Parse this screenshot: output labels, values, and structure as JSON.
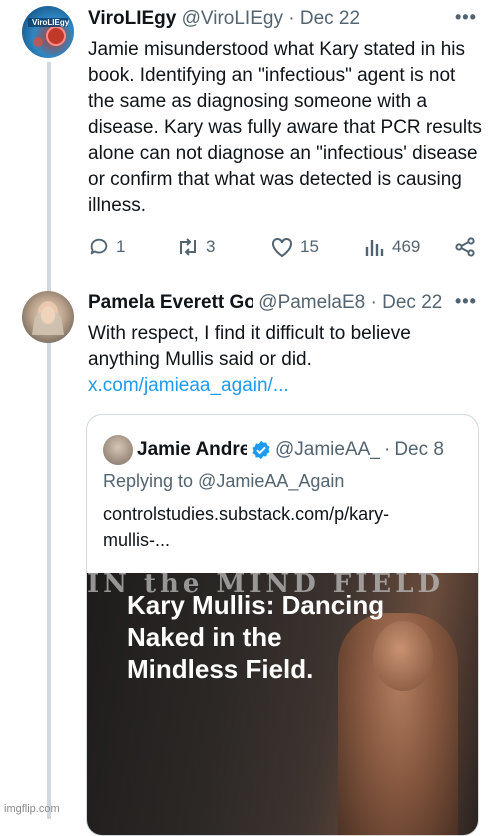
{
  "tweet1": {
    "avatar_text": "ViroLIEgy",
    "name": "ViroLIEgy",
    "handle": "@ViroLIEgy",
    "sep": "·",
    "date": "Dec 22",
    "text": "Jamie misunderstood what Kary stated in his book. Identifying an \"infectious\" agent is not the same as diagnosing someone with a disease. Kary was fully aware that PCR results alone can not diagnose an \"infectious' disease or confirm that what was detected is causing illness.",
    "actions": {
      "replies": "1",
      "reposts": "3",
      "likes": "15",
      "views": "469"
    }
  },
  "tweet2": {
    "name": "Pamela Everett Go",
    "handle": "@PamelaE8",
    "sep": "·",
    "date": "Dec 22",
    "text": "With respect, I find it difficult to believe anything Mullis said or did.",
    "link": "x.com/jamieaa_again/..."
  },
  "quote": {
    "name": "Jamie Andre",
    "handle": "@JamieAA_A",
    "sep": "·",
    "date": "Dec 8",
    "replying": "Replying to @JamieAA_Again",
    "url": "controlstudies.substack.com/p/kary-mullis-...",
    "media_top_text": "IN the MIND FIELD",
    "media_title": "Kary Mullis: Dancing Naked in the Mindless Field."
  },
  "more_icon": "•••",
  "watermark": "imgflip.com",
  "colors": {
    "link": "#1d9bf0",
    "muted": "#536471",
    "verified": "#1d9bf0",
    "thread": "#cfd9de"
  }
}
